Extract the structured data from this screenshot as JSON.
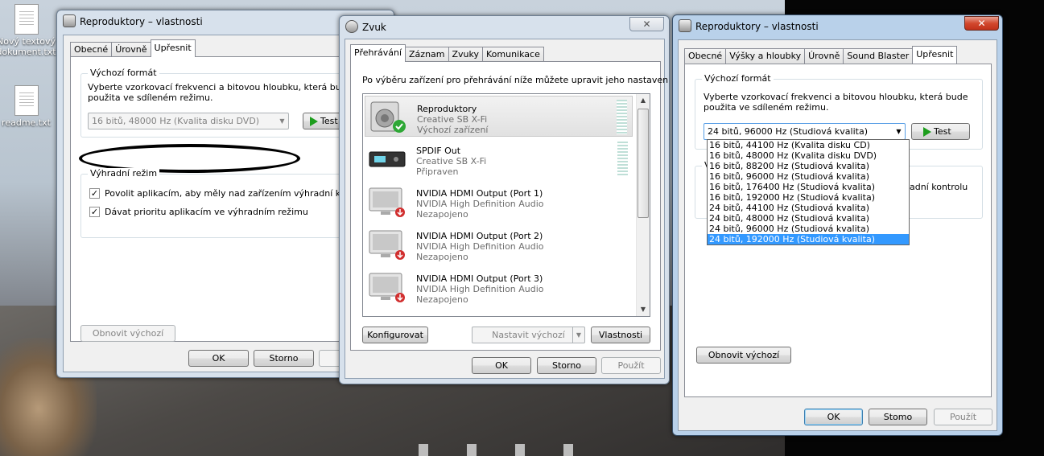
{
  "desktop": {
    "icons": [
      {
        "label_line1": "Nový textový",
        "label_line2": "dokument.txt"
      },
      {
        "label_line1": "readme.txt"
      }
    ]
  },
  "left_window": {
    "title": "Reproduktory – vlastnosti",
    "tabs": [
      "Obecné",
      "Úrovně",
      "Upřesnit"
    ],
    "active_tab": "Upřesnit",
    "default_format": {
      "label": "Výchozí formát",
      "desc_line1": "Vyberte vzorkovací frekvenci a bitovou hloubku, která bude",
      "desc_line2": "použita ve sdíleném režimu.",
      "selected": "16 bitů, 48000 Hz (Kvalita disku DVD)",
      "test": "Test"
    },
    "exclusive": {
      "label": "Výhradní režim",
      "allow": "Povolit aplikacím, aby měly nad zařízením výhradní kontro",
      "priority": "Dávat prioritu aplikacím ve výhradním režimu"
    },
    "restore": "Obnovit výchozí",
    "ok": "OK",
    "cancel": "Storno",
    "apply_partial": "P"
  },
  "sound_window": {
    "title": "Zvuk",
    "close": "✕",
    "tabs": [
      "Přehrávání",
      "Záznam",
      "Zvuky",
      "Komunikace"
    ],
    "active_tab": "Přehrávání",
    "instruction": "Po výběru zařízení pro přehrávání níže můžete upravit jeho nastavení:",
    "devices": [
      {
        "name": "Reproduktory",
        "line2": "Creative SB X-Fi",
        "line3": "Výchozí zařízení",
        "status": "default"
      },
      {
        "name": "SPDIF Out",
        "line2": "Creative SB X-Fi",
        "line3": "Připraven",
        "status": "ready"
      },
      {
        "name": "NVIDIA HDMI Output (Port 1)",
        "line2": "NVIDIA High Definition Audio",
        "line3": "Nezapojeno",
        "status": "unplugged"
      },
      {
        "name": "NVIDIA HDMI Output (Port 2)",
        "line2": "NVIDIA High Definition Audio",
        "line3": "Nezapojeno",
        "status": "unplugged"
      },
      {
        "name": "NVIDIA HDMI Output (Port 3)",
        "line2": "NVIDIA High Definition Audio",
        "line3": "Nezapojeno",
        "status": "unplugged"
      }
    ],
    "configure": "Konfigurovat",
    "set_default": "Nastavit výchozí",
    "properties": "Vlastnosti",
    "ok": "OK",
    "cancel": "Storno",
    "apply": "Použít"
  },
  "right_window": {
    "title": "Reproduktory – vlastnosti",
    "close": "✕",
    "tabs": [
      "Obecné",
      "Výšky a hloubky",
      "Úrovně",
      "Sound Blaster",
      "Upřesnit"
    ],
    "active_tab": "Upřesnit",
    "default_format": {
      "label": "Výchozí formát",
      "desc_line1": "Vyberte vzorkovací frekvenci a bitovou hloubku, která bude",
      "desc_line2": "použita ve sdíleném režimu.",
      "selected": "24 bitů, 96000 Hz (Studiová kvalita)",
      "test": "Test"
    },
    "format_options": [
      "16 bitů, 44100 Hz (Kvalita disku CD)",
      "16 bitů, 48000 Hz (Kvalita disku DVD)",
      "16 bitů, 88200 Hz (Studiová kvalita)",
      "16 bitů, 96000 Hz (Studiová kvalita)",
      "16 bitů, 176400 Hz (Studiová kvalita)",
      "16 bitů, 192000 Hz (Studiová kvalita)",
      "24 bitů, 44100 Hz (Studiová kvalita)",
      "24 bitů, 48000 Hz (Studiová kvalita)",
      "24 bitů, 96000 Hz (Studiová kvalita)",
      "24 bitů, 192000 Hz (Studiová kvalita)"
    ],
    "highlighted_option": "24 bitů, 192000 Hz (Studiová kvalita)",
    "hidden_group_initial": "V",
    "hidden_text": "adní kontrolu",
    "restore": "Obnovit výchozí",
    "ok": "OK",
    "cancel": "Stomo",
    "apply": "Použít"
  },
  "colors": {
    "accent_selection": "#3399ff",
    "default_check": "#2ea836",
    "unplugged_badge": "#d12f2f",
    "test_play": "#1d9d1d"
  }
}
